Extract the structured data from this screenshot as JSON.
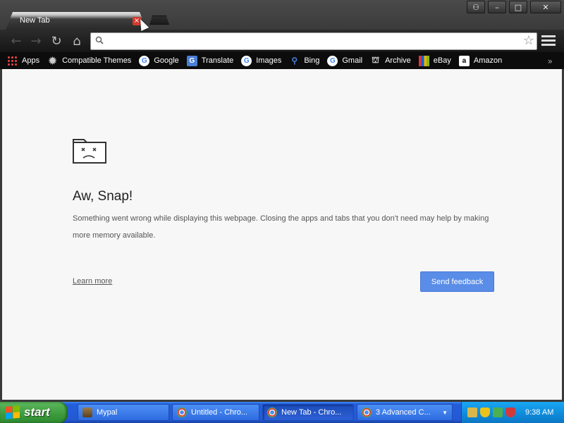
{
  "window": {
    "controls": {
      "account": "⚇",
      "minimize": "–",
      "maximize": "□",
      "close": "✕"
    }
  },
  "tabs": [
    {
      "title": "New Tab",
      "close": "×",
      "active": true
    }
  ],
  "toolbar": {
    "back": "←",
    "forward": "→",
    "reload": "↻",
    "home": "⌂",
    "omnibox": {
      "value": "",
      "placeholder": ""
    },
    "star": "☆"
  },
  "bookmarks": {
    "items": [
      {
        "label": "Apps",
        "icon": "apps-grid-icon"
      },
      {
        "label": "Compatible Themes",
        "icon": "gear-icon"
      },
      {
        "label": "Google",
        "icon": "google-icon"
      },
      {
        "label": "Translate",
        "icon": "translate-icon"
      },
      {
        "label": "Images",
        "icon": "google-icon"
      },
      {
        "label": "Bing",
        "icon": "search-icon"
      },
      {
        "label": "Gmail",
        "icon": "google-icon"
      },
      {
        "label": "Archive",
        "icon": "archive-icon"
      },
      {
        "label": "eBay",
        "icon": "ebay-icon"
      },
      {
        "label": "Amazon",
        "icon": "amazon-icon"
      }
    ],
    "overflow": "»"
  },
  "page": {
    "headline": "Aw, Snap!",
    "message": "Something went wrong while displaying this webpage. Closing the apps and tabs that you don't need may help by making more memory available.",
    "learn_more": "Learn more",
    "send_feedback": "Send feedback",
    "accent": "#5a8de8"
  },
  "taskbar": {
    "start_label": "start",
    "tasks": [
      {
        "label": "Mypal",
        "active": false
      },
      {
        "label": "Untitled - Chro...",
        "active": false
      },
      {
        "label": "New Tab - Chro...",
        "active": true
      },
      {
        "label": "3 Advanced C...",
        "active": false
      }
    ],
    "clock": "9:38 AM"
  }
}
